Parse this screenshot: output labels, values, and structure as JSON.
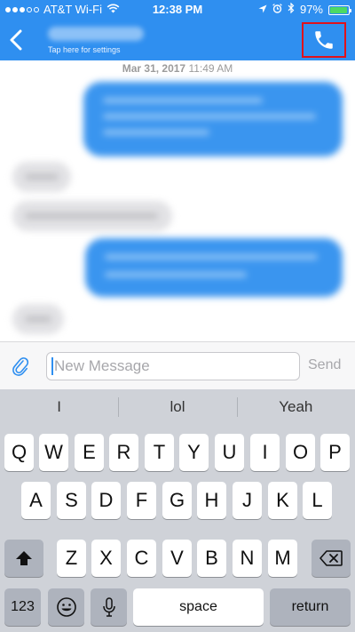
{
  "status": {
    "carrier": "AT&T Wi-Fi",
    "time": "12:38 PM",
    "battery": "97%",
    "battery_level": 0.97,
    "signal_bars_filled": 3,
    "signal_bars_total": 5
  },
  "nav": {
    "subtitle": "Tap here for settings"
  },
  "conversation": {
    "date": "Mar 31, 2017",
    "time": "11:49 AM"
  },
  "input": {
    "placeholder": "New Message",
    "send_label": "Send"
  },
  "suggestions": [
    "I",
    "lol",
    "Yeah"
  ],
  "keyboard": {
    "row1": [
      "Q",
      "W",
      "E",
      "R",
      "T",
      "Y",
      "U",
      "I",
      "O",
      "P"
    ],
    "row2": [
      "A",
      "S",
      "D",
      "F",
      "G",
      "H",
      "J",
      "K",
      "L"
    ],
    "row3": [
      "Z",
      "X",
      "C",
      "V",
      "B",
      "N",
      "M"
    ],
    "numbers_label": "123",
    "space_label": "space",
    "return_label": "return"
  },
  "colors": {
    "accent": "#2f8ff0",
    "outgoing_bubble": "#3a95ef",
    "incoming_bubble": "#e2e2e5",
    "highlight_box": "#e0121b",
    "battery_fill": "#4cd964"
  }
}
